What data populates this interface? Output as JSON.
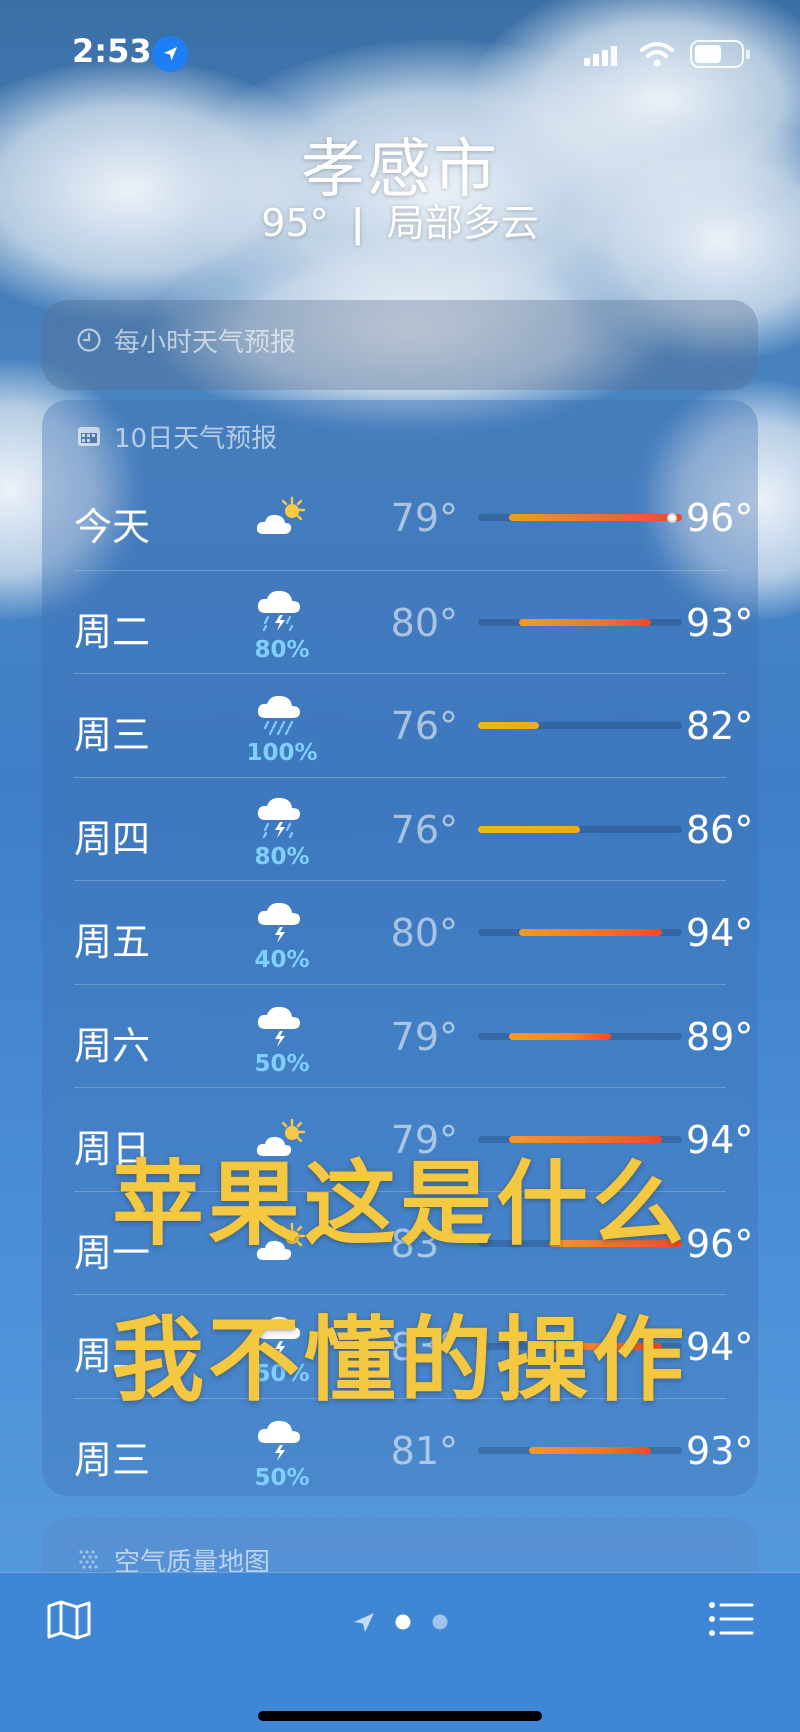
{
  "status_bar": {
    "time": "2:53"
  },
  "location": {
    "city": "孝感市",
    "current": "95°",
    "separator": "|",
    "condition": "局部多云"
  },
  "hourly_card": {
    "title": "每小时天气预报"
  },
  "forecast_card": {
    "title": "10日天气预报",
    "scale": {
      "min": 76,
      "max": 96
    },
    "days": [
      {
        "day": "今天",
        "icon": "sun-cloud-icon",
        "precip": "",
        "low": "79°",
        "high": "96°",
        "low_v": 79,
        "high_v": 96,
        "current_v": 95,
        "color": "#f06a2a"
      },
      {
        "day": "周二",
        "icon": "thunder-rain-icon",
        "precip": "80%",
        "low": "80°",
        "high": "93°",
        "low_v": 80,
        "high_v": 93,
        "color": "#f0772a"
      },
      {
        "day": "周三",
        "icon": "rain-icon",
        "precip": "100%",
        "low": "76°",
        "high": "82°",
        "low_v": 76,
        "high_v": 82,
        "color": "#f5a623"
      },
      {
        "day": "周四",
        "icon": "thunder-rain-icon",
        "precip": "80%",
        "low": "76°",
        "high": "86°",
        "low_v": 76,
        "high_v": 86,
        "color": "#f5a623"
      },
      {
        "day": "周五",
        "icon": "thunder-icon",
        "precip": "40%",
        "low": "80°",
        "high": "94°",
        "low_v": 80,
        "high_v": 94,
        "color": "#f07028"
      },
      {
        "day": "周六",
        "icon": "thunder-icon",
        "precip": "50%",
        "low": "79°",
        "high": "89°",
        "low_v": 79,
        "high_v": 89,
        "color": "#f5852a"
      },
      {
        "day": "周日",
        "icon": "sun-cloud-icon",
        "precip": "",
        "low": "79°",
        "high": "94°",
        "low_v": 79,
        "high_v": 94,
        "color": "#f07028"
      },
      {
        "day": "周一",
        "icon": "sun-cloud-icon",
        "precip": "",
        "low": "83°",
        "high": "96°",
        "low_v": 83,
        "high_v": 96,
        "color": "#f06a2a"
      },
      {
        "day": "周二",
        "icon": "thunder-icon",
        "precip": "50%",
        "low": "83°",
        "high": "94°",
        "low_v": 83,
        "high_v": 94,
        "color": "#f07028"
      },
      {
        "day": "周三",
        "icon": "thunder-icon",
        "precip": "50%",
        "low": "81°",
        "high": "93°",
        "low_v": 81,
        "high_v": 93,
        "color": "#f0772a"
      }
    ]
  },
  "air_quality_card": {
    "title": "空气质量地图"
  },
  "overlay_caption": {
    "line1": "苹果这是什么",
    "line2": "我不懂的操作"
  },
  "colors": {
    "accent_yellow": "#f5c842",
    "location_blue": "#1e7ef5",
    "precip_blue": "#7fd0ff"
  }
}
